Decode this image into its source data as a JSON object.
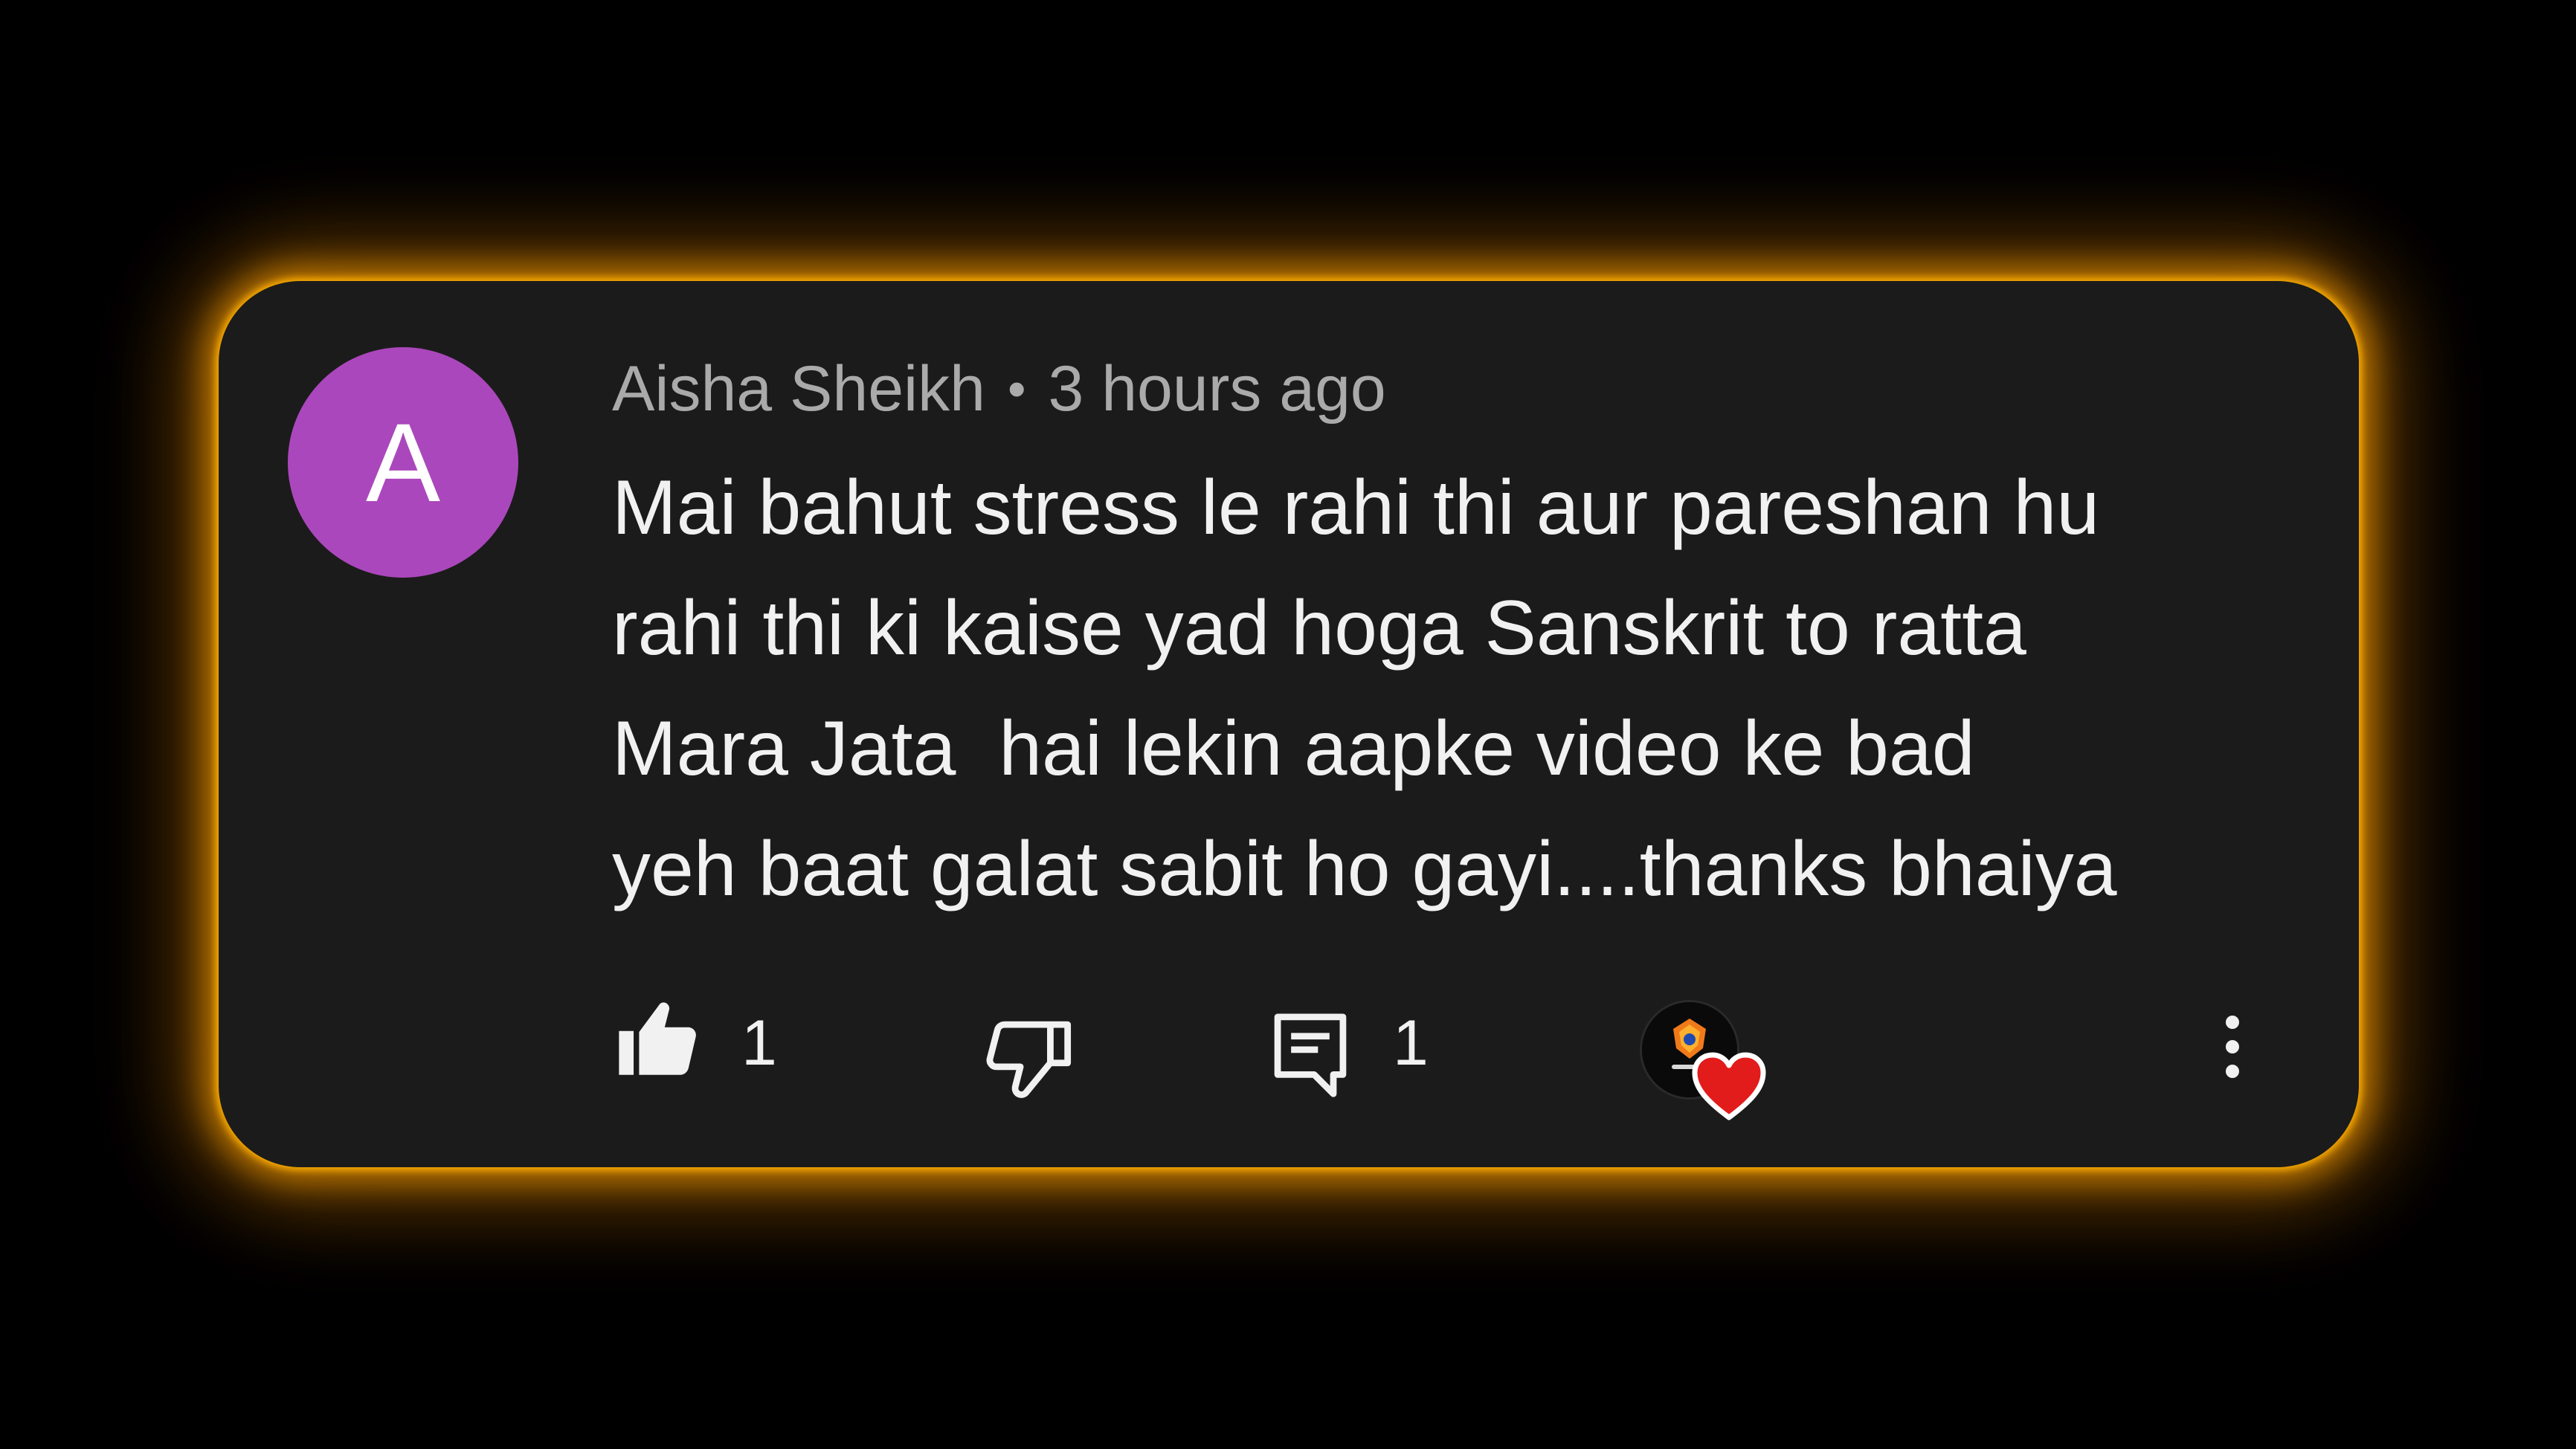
{
  "comment": {
    "avatar_letter": "A",
    "author": "Aisha Sheikh",
    "separator": "•",
    "time": "3 hours ago",
    "text_lines": [
      "Mai bahut stress le rahi thi aur pareshan hu",
      "rahi thi ki kaise yad hoga Sanskrit to ratta",
      "Mara Jata  hai lekin aapke video ke bad",
      "yeh baat galat sabit ho gayi....thanks bhaiya"
    ],
    "like_count": "1",
    "reply_count": "1"
  },
  "icons": {
    "like": "thumbs-up-icon",
    "dislike": "thumbs-down-icon",
    "reply": "reply-comment-icon",
    "creator_heart": "creator-heart-icon",
    "more": "more-vertical-icon"
  },
  "colors": {
    "background": "#000000",
    "card": "#1b1b1b",
    "glow": "#f0a000",
    "avatar": "#ab47bc",
    "text_primary": "#f1f1f1",
    "text_secondary": "#aaaaaa",
    "heart": "#e21b1b"
  }
}
